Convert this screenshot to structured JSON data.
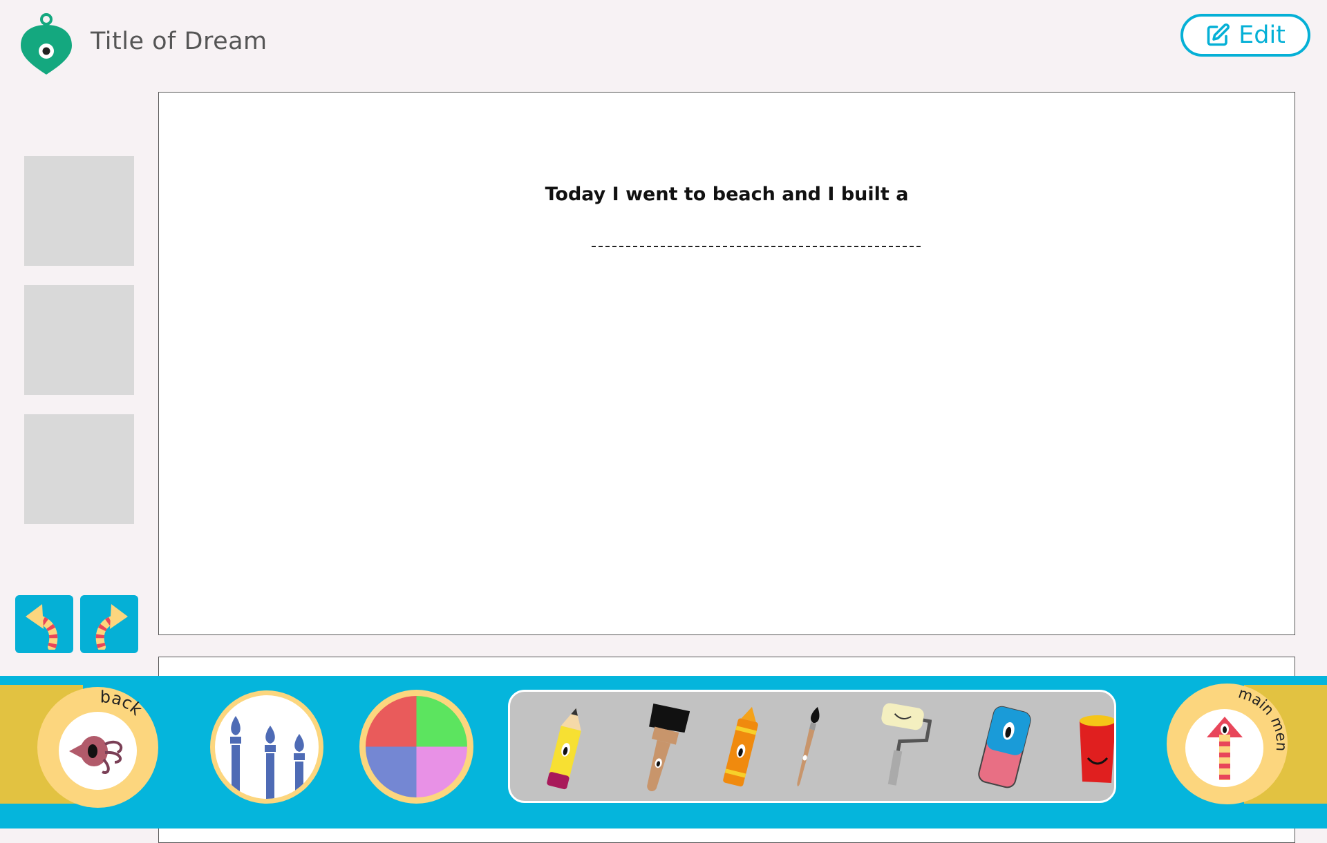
{
  "header": {
    "app_title": "Title of Dream",
    "edit_label": "Edit"
  },
  "sidebar": {
    "thumbnails": [
      "",
      "",
      ""
    ],
    "undo_icon": "undo-arrow-icon",
    "redo_icon": "redo-arrow-icon"
  },
  "canvas": {
    "prompt": "Today I went to beach and I built a"
  },
  "toolbar": {
    "back_label": "back",
    "main_menu_label": "main menu",
    "tools": [
      "pencil",
      "paint-brush",
      "crayon",
      "fine-brush",
      "paint-roller",
      "eraser",
      "paint-bucket"
    ]
  },
  "colors": {
    "accent": "#05b5dc",
    "tab": "#e2c241",
    "button_bg": "#fcd67e",
    "logo": "#14a87f"
  }
}
